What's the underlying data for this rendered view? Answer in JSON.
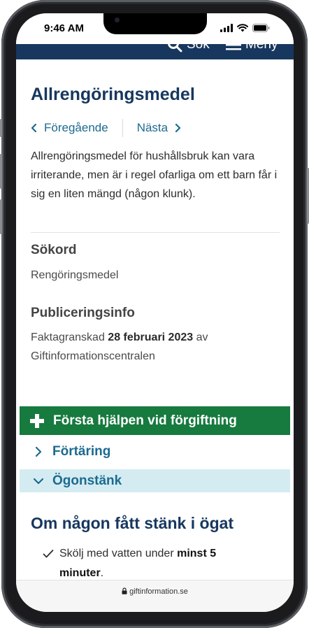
{
  "status": {
    "time": "9:46 AM"
  },
  "nav": {
    "search_label": "Sök",
    "menu_label": "Meny"
  },
  "article": {
    "title": "Allrengöringsmedel",
    "prev_label": "Föregående",
    "next_label": "Nästa",
    "lead": "Allrengöringsmedel för hushållsbruk kan vara irriterande, men är i regel ofarliga om ett barn får i sig en liten mängd (någon klunk)."
  },
  "keywords": {
    "heading": "Sökord",
    "value": "Rengöringsmedel"
  },
  "publication": {
    "heading": "Publiceringsinfo",
    "prefix": "Faktagranskad",
    "date": "28 februari 2023",
    "suffix": "av",
    "org": "Giftinformationscentralen"
  },
  "first_aid": {
    "title": "Första hjälpen vid förgiftning",
    "items": [
      {
        "label": "Förtäring",
        "expanded": false
      },
      {
        "label": "Ögonstänk",
        "expanded": true
      }
    ]
  },
  "eye_section": {
    "heading": "Om någon fått stänk i ögat",
    "step_text": "Skölj med vatten under",
    "step_bold": "minst 5 minuter",
    "step_end": "."
  },
  "browser": {
    "url": "giftinformation.se"
  },
  "colors": {
    "navy": "#17375e",
    "green": "#177a3e",
    "link": "#1c6a91",
    "highlight": "#d4ecf1"
  }
}
